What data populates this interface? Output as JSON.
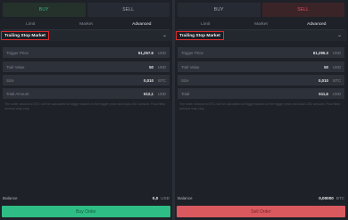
{
  "buy_panel": {
    "side_tabs": {
      "buy": "BUY",
      "sell": "SELL"
    },
    "order_tabs": [
      "Limit",
      "Market",
      "Advanced"
    ],
    "active_order_tab": "Advanced",
    "order_type": "Trailing Stop Market",
    "fields": [
      {
        "label": "Trigger Price",
        "value": "51,257.5",
        "unit": "USD"
      },
      {
        "label": "Trail Value",
        "value": "50",
        "unit": "USD"
      },
      {
        "label": "Size",
        "value": "0,010",
        "unit": "BTC"
      },
      {
        "label": "Total Amount",
        "value": "612,1",
        "unit": "USD"
      }
    ],
    "note": "The order amount in BTC will be calculated at trigger based on the trigger price and total USD amount. Final filled amount may vary.",
    "balance": {
      "label": "Balance",
      "value": "0,0",
      "unit": "USD"
    },
    "submit_label": "Buy Order"
  },
  "sell_panel": {
    "side_tabs": {
      "buy": "BUY",
      "sell": "SELL"
    },
    "order_tabs": [
      "Limit",
      "Market",
      "Advanced"
    ],
    "active_order_tab": "Advanced",
    "order_type": "Trailing Stop Market",
    "fields": [
      {
        "label": "Trigger Price",
        "value": "61,295.3",
        "unit": "USD"
      },
      {
        "label": "Trail Value",
        "value": "50",
        "unit": "USD"
      },
      {
        "label": "Size",
        "value": "0,010",
        "unit": "BTC"
      },
      {
        "label": "Total",
        "value": "611,6",
        "unit": "USD"
      }
    ],
    "note": "The order amount in BTC will be calculated at trigger based on the trigger price and total USD amount. Final filled amount may vary.",
    "balance": {
      "label": "Balance",
      "value": "0,00000",
      "unit": "BTC"
    },
    "submit_label": "Sell Order"
  },
  "colors": {
    "buy_accent": "#2ebd85",
    "sell_accent": "#f6465d",
    "highlight_border": "#e02b2b",
    "background": "#1e2128"
  },
  "icons": {
    "dropdown": "chevron-down-icon"
  }
}
